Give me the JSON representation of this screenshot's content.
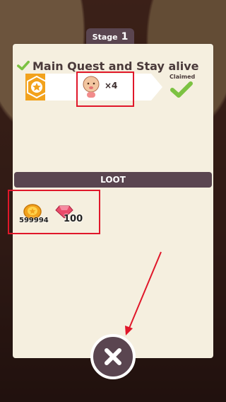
{
  "stage": {
    "label": "Stage",
    "number": "1"
  },
  "quest": {
    "title": "Main Quest and Stay alive",
    "reward_count": "×4",
    "claimed_label": "Claimed",
    "reward_icon": "baby-icon",
    "badge_icon": "star-icon"
  },
  "loot": {
    "header": "LOOT",
    "items": [
      {
        "icon": "coin-icon",
        "value": "599994"
      },
      {
        "icon": "gem-icon",
        "value": "100"
      }
    ]
  },
  "close_button": {
    "icon": "close-icon"
  },
  "colors": {
    "panel": "#f5efdf",
    "header_bar": "#5a4550",
    "accent_orange": "#f2a21c",
    "check_green": "#7cc242",
    "highlight_red": "#e0172a"
  }
}
